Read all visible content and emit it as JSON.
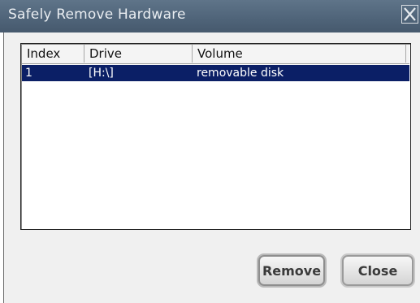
{
  "window": {
    "title": "Safely Remove Hardware",
    "close_icon": "close-icon"
  },
  "list": {
    "columns": [
      "Index",
      "Drive",
      "Volume"
    ],
    "rows": [
      {
        "index": "1",
        "drive": "[H:\\]",
        "volume": "removable disk",
        "selected": true
      }
    ]
  },
  "buttons": {
    "remove_label": "Remove",
    "close_label": "Close"
  },
  "colors": {
    "titlebar": "#50657a",
    "selection": "#0b1f66",
    "panel": "#f0f0f0"
  }
}
